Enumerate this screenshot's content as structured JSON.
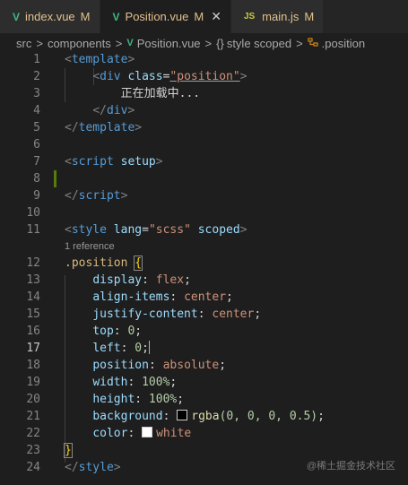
{
  "tabs": [
    {
      "icon": "V",
      "name": "index.vue",
      "status": "M"
    },
    {
      "icon": "V",
      "name": "Position.vue",
      "status": "M",
      "close": "✕"
    },
    {
      "icon": "JS",
      "name": "main.js",
      "status": "M"
    }
  ],
  "breadcrumb": {
    "folder1": "src",
    "folder2": "components",
    "file": "Position.vue",
    "braces": "{}",
    "section": "style scoped",
    "symbol": ".position",
    "sep": ">"
  },
  "editor": {
    "code_lens": "1 reference",
    "lines": {
      "n1": "1",
      "n2": "2",
      "n3": "3",
      "n4": "4",
      "n5": "5",
      "n6": "6",
      "n7": "7",
      "n8": "8",
      "n9": "9",
      "n10": "10",
      "n11": "11",
      "n12": "12",
      "n13": "13",
      "n14": "14",
      "n15": "15",
      "n16": "16",
      "n17": "17",
      "n18": "18",
      "n19": "19",
      "n20": "20",
      "n21": "21",
      "n22": "22",
      "n23": "23",
      "n24": "24"
    },
    "tokens": {
      "lt": "<",
      "gt": ">",
      "lts": "</",
      "eq": "=",
      "semi": ";",
      "colon": ":",
      "template": "template",
      "div": "div",
      "class": "class",
      "class_val": "\"position\"",
      "loading_text": "正在加载中...",
      "script": "script",
      "setup": "setup",
      "style": "style",
      "lang": "lang",
      "lang_val": "\"scss\"",
      "scoped": "scoped",
      "selector": ".position",
      "open_brace": "{",
      "close_brace": "}",
      "p_display": "display",
      "v_flex": "flex",
      "p_align": "align-items",
      "v_center": "center",
      "p_justify": "justify-content",
      "p_top": "top",
      "p_left": "left",
      "v_zero": "0",
      "p_position": "position",
      "v_absolute": "absolute",
      "p_width": "width",
      "p_height": "height",
      "v_100": "100%",
      "p_background": "background",
      "fn_rgba": "rgba",
      "rgba_args": "(0, 0, 0, 0.5)",
      "p_color": "color",
      "v_white": "white"
    }
  },
  "swatches": {
    "background": "#000000",
    "color": "#ffffff"
  },
  "watermark": "@稀土掘金技术社区",
  "colors": {
    "vue_green": "#41b883",
    "modified": "#e2c08d",
    "tag": "#569cd6",
    "string": "#ce9178",
    "property": "#9cdcfe",
    "number": "#b5cea8",
    "function": "#dcdcaa",
    "selector": "#d7ba7d"
  }
}
